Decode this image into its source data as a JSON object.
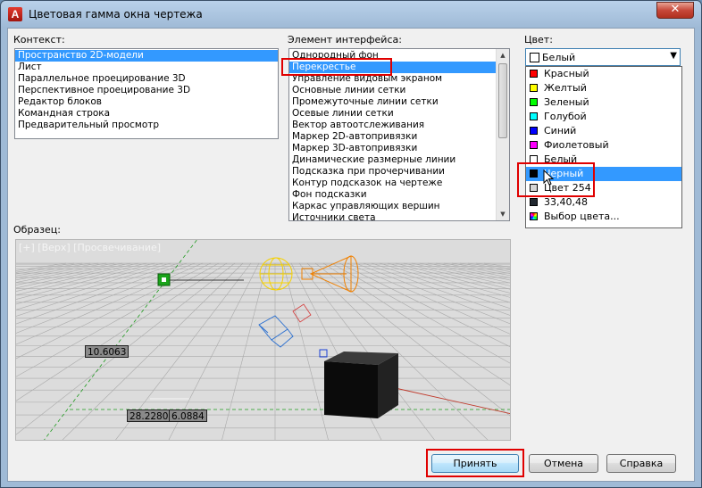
{
  "window": {
    "title": "Цветовая гамма окна чертежа",
    "close_glyph": "✕",
    "app_icon_letter": "A"
  },
  "context": {
    "label": "Контекст:",
    "selected_index": 0,
    "items": [
      "Пространство 2D-модели",
      "Лист",
      "Параллельное проецирование 3D",
      "Перспективное проецирование 3D",
      "Редактор блоков",
      "Командная строка",
      "Предварительный просмотр"
    ]
  },
  "interface_element": {
    "label": "Элемент интерфейса:",
    "selected_index": 1,
    "items": [
      "Однородный фон",
      "Перекрестье",
      "Управление видовым экраном",
      "Основные линии сетки",
      "Промежуточные линии сетки",
      "Осевые линии сетки",
      "Вектор автоотслеживания",
      "Маркер 2D-автопривязки",
      "Маркер 3D-автопривязки",
      "Динамические размерные линии",
      "Подсказка при прочерчивании",
      "Контур подсказок на чертеже",
      "Фон подсказки",
      "Каркас управляющих вершин",
      "Источники света"
    ]
  },
  "color": {
    "label": "Цвет:",
    "current_value": "Белый",
    "current_swatch": "#ffffff",
    "selected_index": 7,
    "options": [
      {
        "label": "Красный",
        "swatch": "#ff0000"
      },
      {
        "label": "Желтый",
        "swatch": "#ffff00"
      },
      {
        "label": "Зеленый",
        "swatch": "#00ff00"
      },
      {
        "label": "Голубой",
        "swatch": "#00ffff"
      },
      {
        "label": "Синий",
        "swatch": "#0000ff"
      },
      {
        "label": "Фиолетовый",
        "swatch": "#ff00ff"
      },
      {
        "label": "Белый",
        "swatch": "#ffffff"
      },
      {
        "label": "Черный",
        "swatch": "#000000"
      },
      {
        "label": "Цвет 254",
        "swatch": "#d6d6d6"
      },
      {
        "label": "33,40,48",
        "swatch": "#212830"
      },
      {
        "label": "Выбор цвета...",
        "swatch": "picker"
      }
    ]
  },
  "preview": {
    "label": "Образец:",
    "viewport_caption": "[+] [Верх] [Просвечивание]",
    "dim_a": "10.6063",
    "dim_b": "28.2280",
    "dim_c": "6.0884"
  },
  "buttons": {
    "accept": "Принять",
    "cancel": "Отмена",
    "help": "Справка"
  },
  "colors": {
    "highlight": "#e00000",
    "selection": "#3399ff"
  }
}
